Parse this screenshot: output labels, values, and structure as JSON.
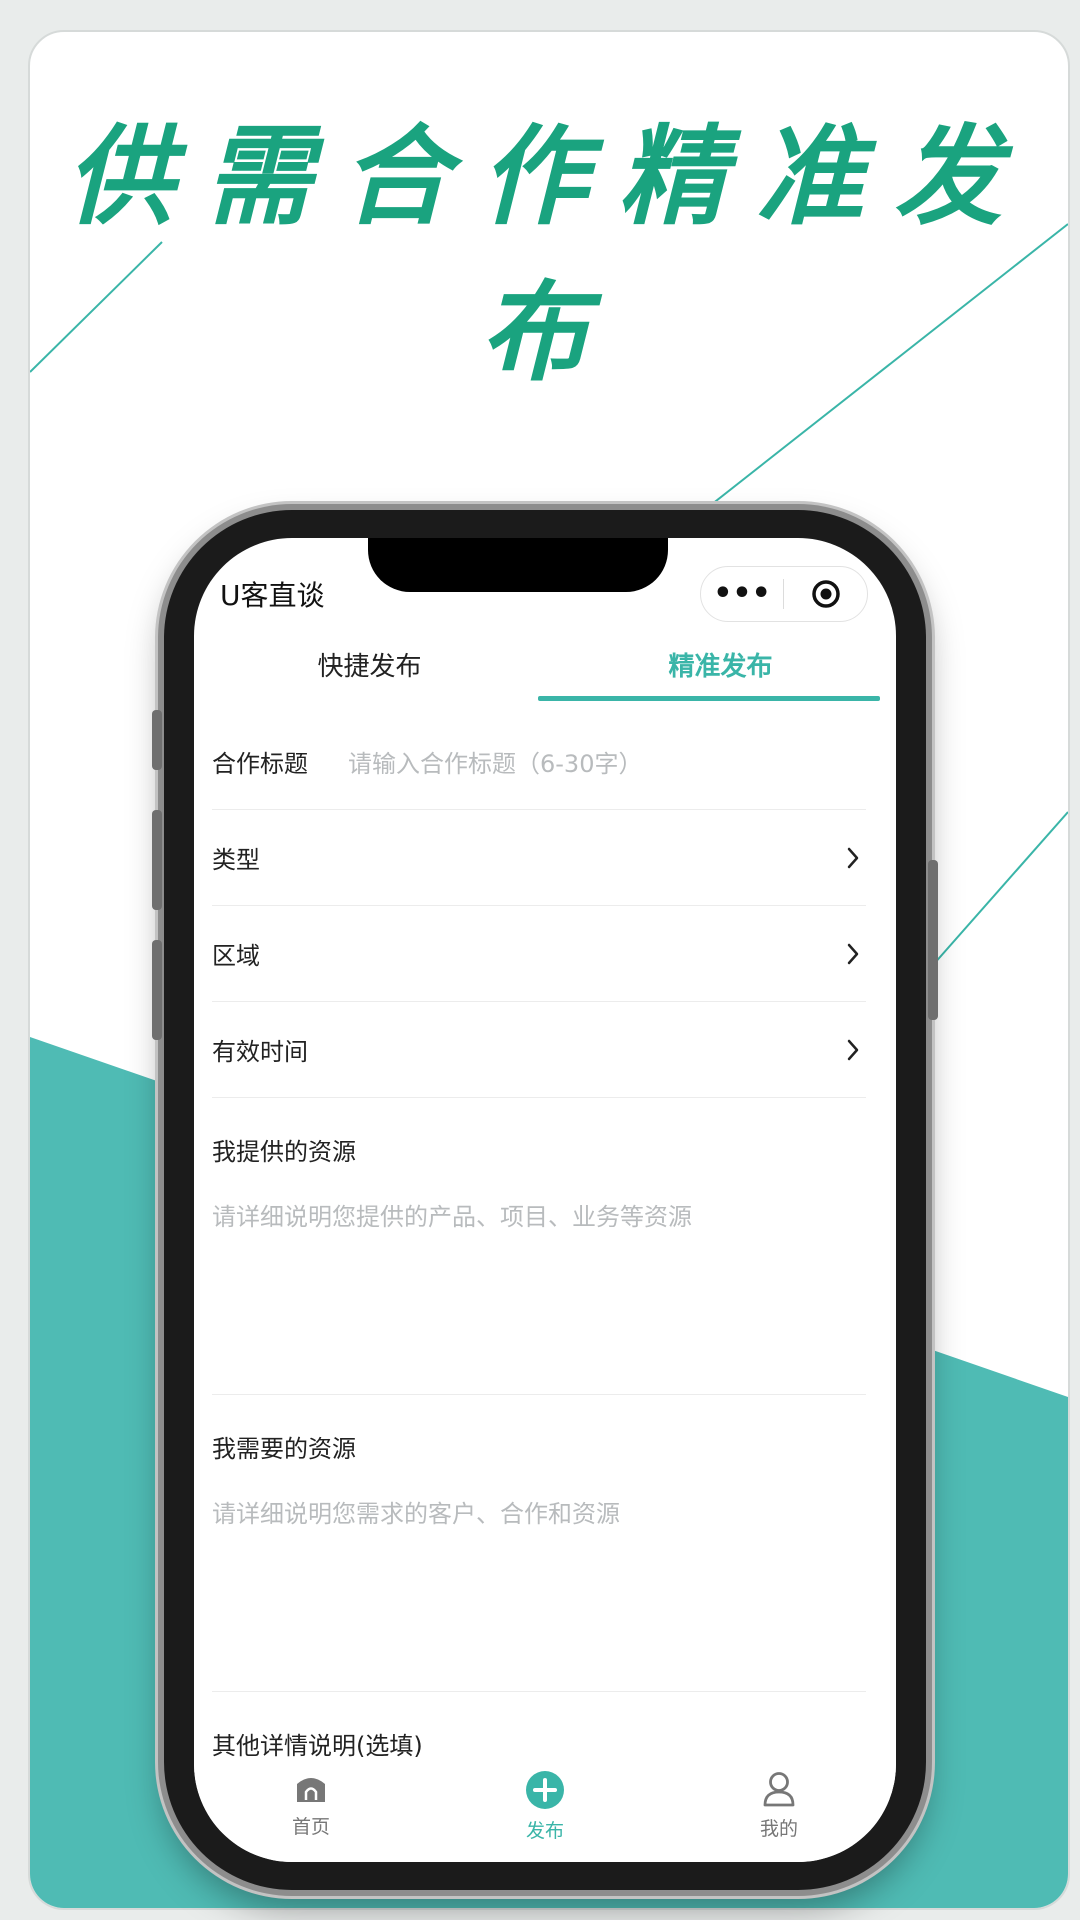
{
  "headline": "供需合作精准发布",
  "colors": {
    "accent": "#3ab5a8",
    "headline": "#1aa37f",
    "teal_bg": "#4fbbb4",
    "placeholder": "#b8bbbd"
  },
  "app": {
    "title": "U客直谈",
    "capsule_more": "•••"
  },
  "tabs": [
    {
      "label": "快捷发布",
      "active": false
    },
    {
      "label": "精准发布",
      "active": true
    }
  ],
  "form": {
    "title_label": "合作标题",
    "title_placeholder": "请输入合作标题（6-30字）",
    "type_label": "类型",
    "region_label": "区域",
    "valid_time_label": "有效时间",
    "provide_label": "我提供的资源",
    "provide_placeholder": "请详细说明您提供的产品、项目、业务等资源",
    "need_label": "我需要的资源",
    "need_placeholder": "请详细说明您需求的客户、合作和资源",
    "other_label": "其他详情说明(选填)"
  },
  "tabbar": [
    {
      "label": "首页",
      "icon": "home-icon",
      "active": false
    },
    {
      "label": "发布",
      "icon": "plus-circle-icon",
      "active": true
    },
    {
      "label": "我的",
      "icon": "user-icon",
      "active": false
    }
  ]
}
